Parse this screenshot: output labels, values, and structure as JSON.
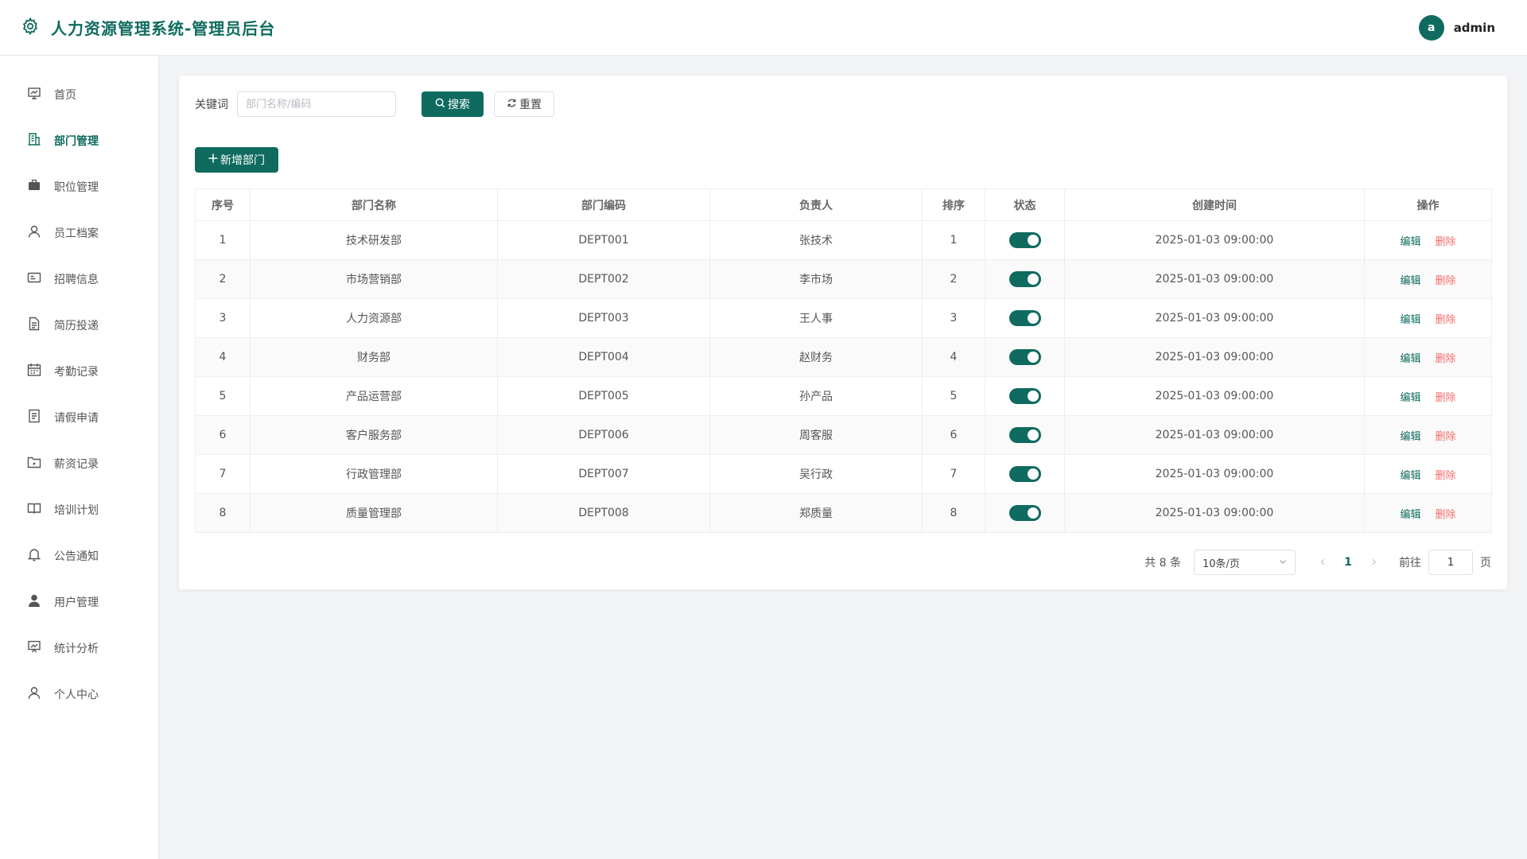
{
  "header": {
    "title": "人力资源管理系统-管理员后台",
    "avatar_letter": "a",
    "username": "admin"
  },
  "sidebar": {
    "items": [
      {
        "label": "首页",
        "icon": "dashboard-icon",
        "active": false
      },
      {
        "label": "部门管理",
        "icon": "building-icon",
        "active": true
      },
      {
        "label": "职位管理",
        "icon": "briefcase-icon",
        "active": false
      },
      {
        "label": "员工档案",
        "icon": "user-icon",
        "active": false
      },
      {
        "label": "招聘信息",
        "icon": "id-card-icon",
        "active": false
      },
      {
        "label": "简历投递",
        "icon": "document-icon",
        "active": false
      },
      {
        "label": "考勤记录",
        "icon": "calendar-icon",
        "active": false
      },
      {
        "label": "请假申请",
        "icon": "form-icon",
        "active": false
      },
      {
        "label": "薪资记录",
        "icon": "folder-icon",
        "active": false
      },
      {
        "label": "培训计划",
        "icon": "book-icon",
        "active": false
      },
      {
        "label": "公告通知",
        "icon": "bell-icon",
        "active": false
      },
      {
        "label": "用户管理",
        "icon": "user-filled-icon",
        "active": false
      },
      {
        "label": "统计分析",
        "icon": "chart-icon",
        "active": false
      },
      {
        "label": "个人中心",
        "icon": "user-icon",
        "active": false
      }
    ]
  },
  "search": {
    "label": "关键词",
    "placeholder": "部门名称/编码",
    "value": "",
    "search_label": "搜索",
    "reset_label": "重置"
  },
  "toolbar": {
    "add_label": "新增部门"
  },
  "table": {
    "columns": [
      "序号",
      "部门名称",
      "部门编码",
      "负责人",
      "排序",
      "状态",
      "创建时间",
      "操作"
    ],
    "edit_label": "编辑",
    "delete_label": "删除",
    "rows": [
      {
        "index": "1",
        "name": "技术研发部",
        "code": "DEPT001",
        "manager": "张技术",
        "sort": "1",
        "status": true,
        "created": "2025-01-03 09:00:00"
      },
      {
        "index": "2",
        "name": "市场营销部",
        "code": "DEPT002",
        "manager": "李市场",
        "sort": "2",
        "status": true,
        "created": "2025-01-03 09:00:00"
      },
      {
        "index": "3",
        "name": "人力资源部",
        "code": "DEPT003",
        "manager": "王人事",
        "sort": "3",
        "status": true,
        "created": "2025-01-03 09:00:00"
      },
      {
        "index": "4",
        "name": "财务部",
        "code": "DEPT004",
        "manager": "赵财务",
        "sort": "4",
        "status": true,
        "created": "2025-01-03 09:00:00"
      },
      {
        "index": "5",
        "name": "产品运营部",
        "code": "DEPT005",
        "manager": "孙产品",
        "sort": "5",
        "status": true,
        "created": "2025-01-03 09:00:00"
      },
      {
        "index": "6",
        "name": "客户服务部",
        "code": "DEPT006",
        "manager": "周客服",
        "sort": "6",
        "status": true,
        "created": "2025-01-03 09:00:00"
      },
      {
        "index": "7",
        "name": "行政管理部",
        "code": "DEPT007",
        "manager": "吴行政",
        "sort": "7",
        "status": true,
        "created": "2025-01-03 09:00:00"
      },
      {
        "index": "8",
        "name": "质量管理部",
        "code": "DEPT008",
        "manager": "郑质量",
        "sort": "8",
        "status": true,
        "created": "2025-01-03 09:00:00"
      }
    ]
  },
  "pagination": {
    "total_text": "共 8 条",
    "page_size": "10条/页",
    "current_page": "1",
    "goto_label": "前往",
    "goto_value": "1",
    "page_suffix": "页"
  },
  "colors": {
    "primary": "#0f6b5f",
    "danger": "#f56c6c"
  }
}
